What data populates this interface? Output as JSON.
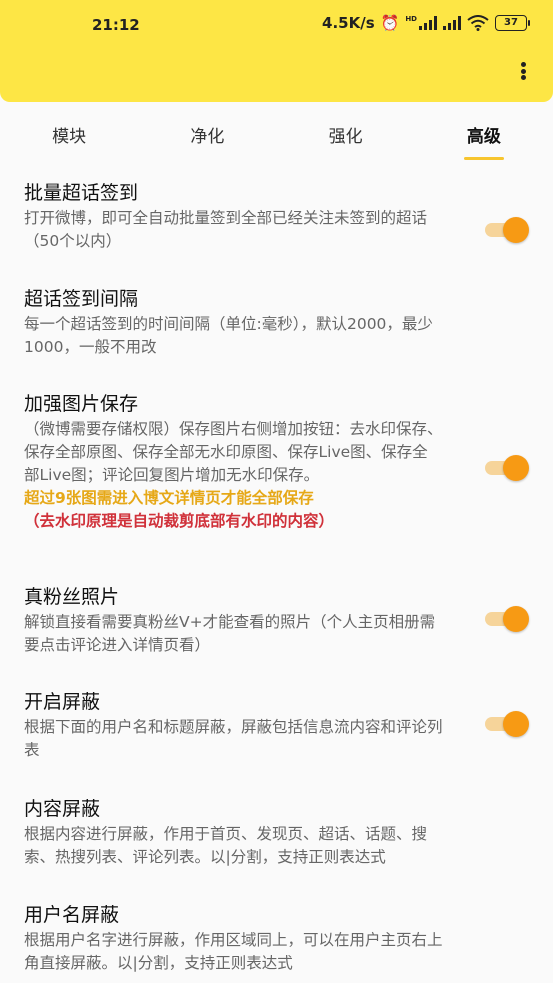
{
  "status_bar": {
    "time": "21:12",
    "net_speed": "4.5K/s",
    "alarm_icon": "alarm-clock-icon",
    "hd_label": "HD",
    "battery": "37"
  },
  "app_bar": {
    "color": "#fde645",
    "more_icon": "more-vert-icon"
  },
  "tabs": [
    {
      "label": "模块",
      "active": false
    },
    {
      "label": "净化",
      "active": false
    },
    {
      "label": "强化",
      "active": false
    },
    {
      "label": "高级",
      "active": true
    }
  ],
  "accent": "#f79a14",
  "settings": [
    {
      "title": "批量超话签到",
      "desc": "打开微博，即可全自动批量签到全部已经关注未签到的超话（50个以内）",
      "toggle": true,
      "enabled": true
    },
    {
      "title": "超话签到间隔",
      "desc": "每一个超话签到的时间间隔（单位:毫秒），默认2000，最少1000，一般不用改",
      "toggle": false
    },
    {
      "title": "加强图片保存",
      "desc": "（微博需要存储权限）保存图片右侧增加按钮：去水印保存、保存全部原图、保存全部无水印原图、保存Live图、保存全部Live图；评论回复图片增加无水印保存。",
      "warn1": "超过9张图需进入博文详情页才能全部保存",
      "warn2": "（去水印原理是自动裁剪底部有水印的内容）",
      "toggle": true,
      "enabled": true
    },
    {
      "title": "真粉丝照片",
      "desc": "解锁直接看需要真粉丝V+才能查看的照片（个人主页相册需要点击评论进入详情页看）",
      "toggle": true,
      "enabled": true
    },
    {
      "title": "开启屏蔽",
      "desc": "根据下面的用户名和标题屏蔽，屏蔽包括信息流内容和评论列表",
      "toggle": true,
      "enabled": true
    },
    {
      "title": "内容屏蔽",
      "desc": "根据内容进行屏蔽，作用于首页、发现页、超话、话题、搜索、热搜列表、评论列表。以|分割，支持正则表达式",
      "toggle": false
    },
    {
      "title": "用户名屏蔽",
      "desc": "根据用户名字进行屏蔽，作用区域同上，可以在用户主页右上角直接屏蔽。以|分割，支持正则表达式",
      "toggle": false
    }
  ]
}
